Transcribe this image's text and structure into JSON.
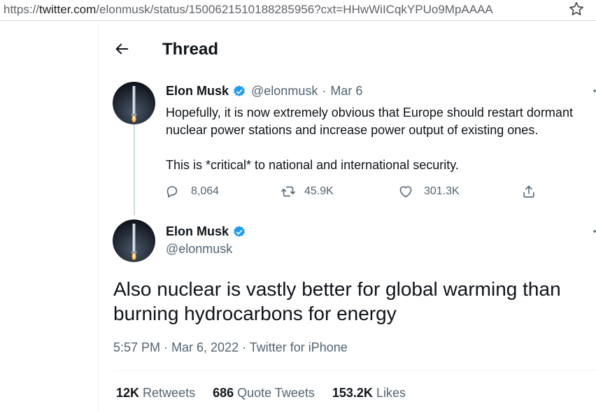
{
  "browser": {
    "url_prefix": "https://",
    "url_domain": "twitter.com",
    "url_path": "/elonmusk/status/1500621510188285956?cxt=HHwWiICqkYPUo9MpAAAA"
  },
  "header": {
    "title": "Thread"
  },
  "tweet1": {
    "name": "Elon Musk",
    "handle": "@elonmusk",
    "separator": "·",
    "date": "Mar 6",
    "text_p1": "Hopefully, it is now extremely obvious that Europe should restart dormant nuclear power stations and increase power output of existing ones.",
    "text_p2": "This is *critical* to national and international security.",
    "replies": "8,064",
    "retweets": "45.9K",
    "likes": "301.3K"
  },
  "tweet2": {
    "name": "Elon Musk",
    "handle": "@elonmusk",
    "text": "Also nuclear is vastly better for global warming than burning hydrocarbons for energy",
    "meta": "5:57 PM · Mar 6, 2022 · Twitter for iPhone",
    "stats": {
      "retweets_count": "12K",
      "retweets_label": "Retweets",
      "quotes_count": "686",
      "quotes_label": "Quote Tweets",
      "likes_count": "153.2K",
      "likes_label": "Likes"
    }
  },
  "icons": {
    "back": "arrow-left-icon",
    "verified": "verified-badge-icon",
    "reply": "reply-icon",
    "retweet": "retweet-icon",
    "like": "heart-icon",
    "share": "share-icon",
    "more": "more-icon",
    "bookmark": "star-icon"
  },
  "colors": {
    "verified": "#1d9bf0",
    "secondary_text": "#536471",
    "primary_text": "#0f1419"
  }
}
